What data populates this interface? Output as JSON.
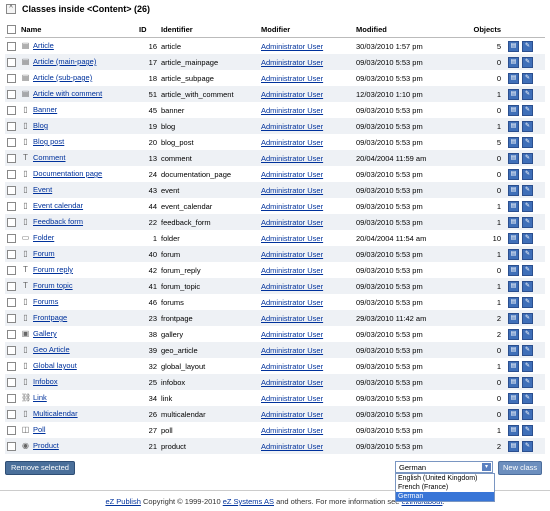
{
  "header": {
    "title": "Classes inside <Content> (26)",
    "toggle": "^"
  },
  "columns": {
    "name": "Name",
    "id": "ID",
    "identifier": "Identifier",
    "modifier": "Modifier",
    "modified": "Modified",
    "objects": "Objects"
  },
  "rows": [
    {
      "name": "Article",
      "id": "16",
      "identifier": "article",
      "modifier": "Administrator User",
      "modified": "30/03/2010 1:57 pm",
      "objects": "5",
      "icon": "doc-lines"
    },
    {
      "name": "Article (main-page)",
      "id": "17",
      "identifier": "article_mainpage",
      "modifier": "Administrator User",
      "modified": "09/03/2010 5:53 pm",
      "objects": "0",
      "icon": "doc-lines"
    },
    {
      "name": "Article (sub-page)",
      "id": "18",
      "identifier": "article_subpage",
      "modifier": "Administrator User",
      "modified": "09/03/2010 5:53 pm",
      "objects": "0",
      "icon": "doc-lines"
    },
    {
      "name": "Article with comment",
      "id": "51",
      "identifier": "article_with_comment",
      "modifier": "Administrator User",
      "modified": "12/03/2010 1:10 pm",
      "objects": "1",
      "icon": "doc-lines"
    },
    {
      "name": "Banner",
      "id": "45",
      "identifier": "banner",
      "modifier": "Administrator User",
      "modified": "09/03/2010 5:53 pm",
      "objects": "0",
      "icon": "doc"
    },
    {
      "name": "Blog",
      "id": "19",
      "identifier": "blog",
      "modifier": "Administrator User",
      "modified": "09/03/2010 5:53 pm",
      "objects": "1",
      "icon": "doc"
    },
    {
      "name": "Blog post",
      "id": "20",
      "identifier": "blog_post",
      "modifier": "Administrator User",
      "modified": "09/03/2010 5:53 pm",
      "objects": "5",
      "icon": "doc"
    },
    {
      "name": "Comment",
      "id": "13",
      "identifier": "comment",
      "modifier": "Administrator User",
      "modified": "20/04/2004 11:59 am",
      "objects": "0",
      "icon": "text"
    },
    {
      "name": "Documentation page",
      "id": "24",
      "identifier": "documentation_page",
      "modifier": "Administrator User",
      "modified": "09/03/2010 5:53 pm",
      "objects": "0",
      "icon": "doc"
    },
    {
      "name": "Event",
      "id": "43",
      "identifier": "event",
      "modifier": "Administrator User",
      "modified": "09/03/2010 5:53 pm",
      "objects": "0",
      "icon": "doc"
    },
    {
      "name": "Event calendar",
      "id": "44",
      "identifier": "event_calendar",
      "modifier": "Administrator User",
      "modified": "09/03/2010 5:53 pm",
      "objects": "1",
      "icon": "doc"
    },
    {
      "name": "Feedback form",
      "id": "22",
      "identifier": "feedback_form",
      "modifier": "Administrator User",
      "modified": "09/03/2010 5:53 pm",
      "objects": "1",
      "icon": "doc"
    },
    {
      "name": "Folder",
      "id": "1",
      "identifier": "folder",
      "modifier": "Administrator User",
      "modified": "20/04/2004 11:54 am",
      "objects": "10",
      "icon": "folder"
    },
    {
      "name": "Forum",
      "id": "40",
      "identifier": "forum",
      "modifier": "Administrator User",
      "modified": "09/03/2010 5:53 pm",
      "objects": "1",
      "icon": "doc"
    },
    {
      "name": "Forum reply",
      "id": "42",
      "identifier": "forum_reply",
      "modifier": "Administrator User",
      "modified": "09/03/2010 5:53 pm",
      "objects": "0",
      "icon": "text"
    },
    {
      "name": "Forum topic",
      "id": "41",
      "identifier": "forum_topic",
      "modifier": "Administrator User",
      "modified": "09/03/2010 5:53 pm",
      "objects": "1",
      "icon": "text"
    },
    {
      "name": "Forums",
      "id": "46",
      "identifier": "forums",
      "modifier": "Administrator User",
      "modified": "09/03/2010 5:53 pm",
      "objects": "1",
      "icon": "doc"
    },
    {
      "name": "Frontpage",
      "id": "23",
      "identifier": "frontpage",
      "modifier": "Administrator User",
      "modified": "29/03/2010 11:42 am",
      "objects": "2",
      "icon": "doc"
    },
    {
      "name": "Gallery",
      "id": "38",
      "identifier": "gallery",
      "modifier": "Administrator User",
      "modified": "09/03/2010 5:53 pm",
      "objects": "2",
      "icon": "gallery"
    },
    {
      "name": "Geo Article",
      "id": "39",
      "identifier": "geo_article",
      "modifier": "Administrator User",
      "modified": "09/03/2010 5:53 pm",
      "objects": "0",
      "icon": "doc"
    },
    {
      "name": "Global layout",
      "id": "32",
      "identifier": "global_layout",
      "modifier": "Administrator User",
      "modified": "09/03/2010 5:53 pm",
      "objects": "1",
      "icon": "doc"
    },
    {
      "name": "Infobox",
      "id": "25",
      "identifier": "infobox",
      "modifier": "Administrator User",
      "modified": "09/03/2010 5:53 pm",
      "objects": "0",
      "icon": "doc"
    },
    {
      "name": "Link",
      "id": "34",
      "identifier": "link",
      "modifier": "Administrator User",
      "modified": "09/03/2010 5:53 pm",
      "objects": "0",
      "icon": "link"
    },
    {
      "name": "Multicalendar",
      "id": "26",
      "identifier": "multicalendar",
      "modifier": "Administrator User",
      "modified": "09/03/2010 5:53 pm",
      "objects": "0",
      "icon": "doc"
    },
    {
      "name": "Poll",
      "id": "27",
      "identifier": "poll",
      "modifier": "Administrator User",
      "modified": "09/03/2010 5:53 pm",
      "objects": "1",
      "icon": "poll"
    },
    {
      "name": "Product",
      "id": "21",
      "identifier": "product",
      "modifier": "Administrator User",
      "modified": "09/03/2010 5:53 pm",
      "objects": "2",
      "icon": "product"
    }
  ],
  "actions": {
    "remove_label": "Remove selected",
    "new_class_label": "New class"
  },
  "language_select": {
    "value": "German",
    "options": [
      "English (United Kingdom)",
      "French (France)",
      "German"
    ]
  },
  "footer": {
    "link1": "eZ Publish",
    "text1": " Copyright © 1999-2010 ",
    "link2": "eZ Systems AS",
    "text2": " and others. For more information see ",
    "link3": "ezinfo/about",
    "text3": "."
  },
  "colors": {
    "link": "#00329c",
    "row_alt": "#eef1f5",
    "button": "#4a6f9a",
    "selected_option": "#3875d7"
  }
}
